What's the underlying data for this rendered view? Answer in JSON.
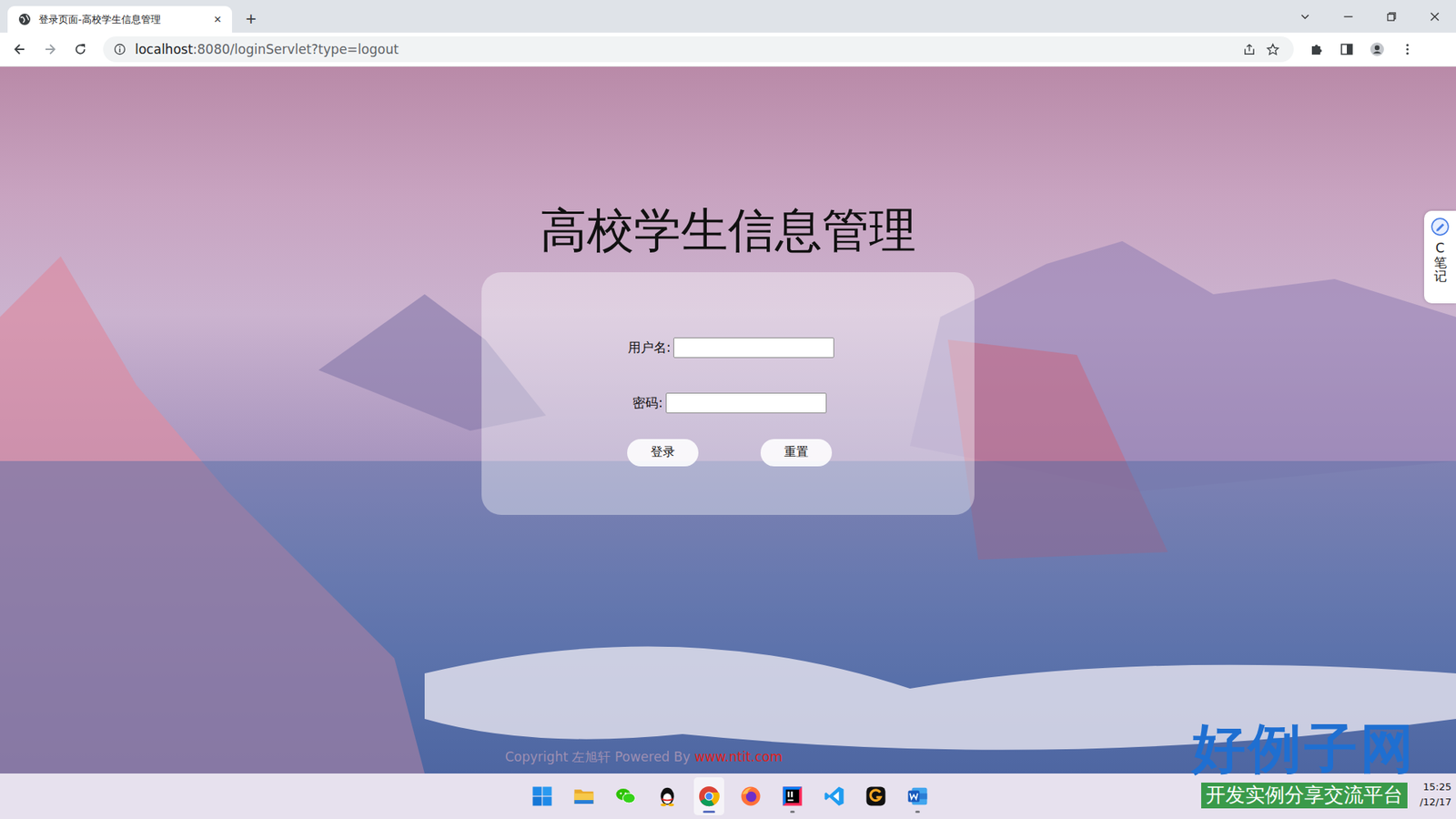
{
  "window": {
    "tab_title": "登录页面-高校学生信息管理",
    "tab_close": "×",
    "new_tab": "+"
  },
  "address_bar": {
    "host": "localhost",
    "path": ":8080/loginServlet?type=logout"
  },
  "page": {
    "title": "高校学生信息管理",
    "fields": [
      {
        "label": "用户名:",
        "kind": "text"
      },
      {
        "label": "密码:",
        "kind": "password"
      }
    ],
    "buttons": [
      "登录",
      "重置"
    ],
    "copyright": "Copyright 左旭轩 Powered By ",
    "copyright_link": "www.ntit.com"
  },
  "side_widget": {
    "label": "C笔记"
  },
  "taskbar": {
    "apps": [
      {
        "kind": "start",
        "running": false,
        "selected": false
      },
      {
        "kind": "explorer",
        "running": false,
        "selected": false
      },
      {
        "kind": "wechat",
        "running": false,
        "selected": false
      },
      {
        "kind": "qq",
        "running": false,
        "selected": false
      },
      {
        "kind": "chrome",
        "running": true,
        "selected": true
      },
      {
        "kind": "firefox",
        "running": false,
        "selected": false
      },
      {
        "kind": "intellij",
        "running": true,
        "selected": false
      },
      {
        "kind": "vscode",
        "running": false,
        "selected": false
      },
      {
        "kind": "grammar",
        "running": false,
        "selected": false
      },
      {
        "kind": "word",
        "running": true,
        "selected": false
      }
    ],
    "time": "15:25",
    "date": "/12/17"
  },
  "watermark": {
    "title": "好例子网",
    "subtitle": "开发实例分享交流平台"
  }
}
